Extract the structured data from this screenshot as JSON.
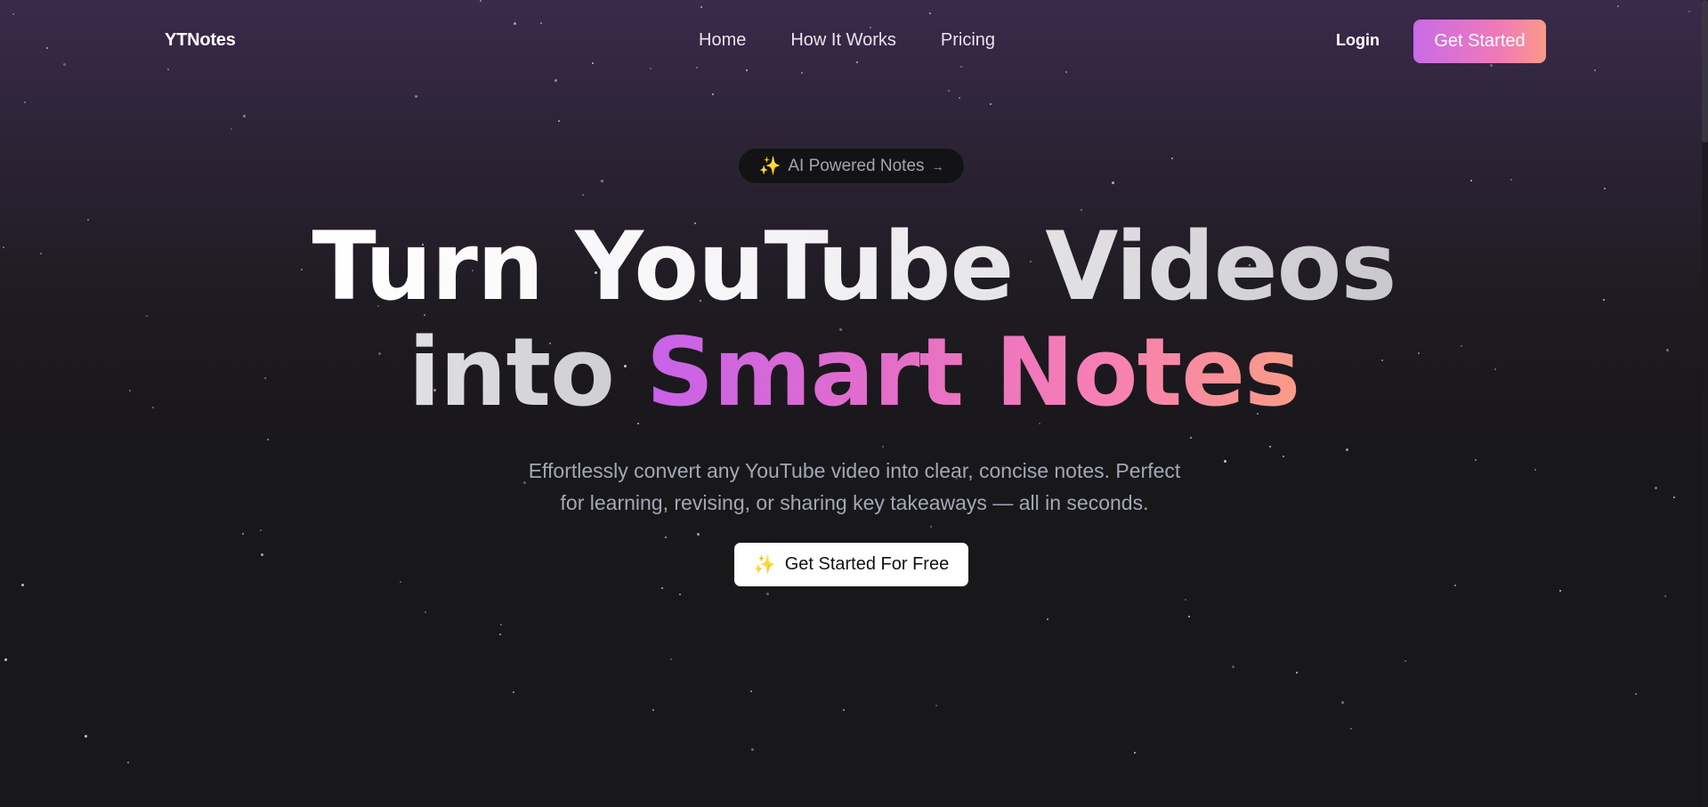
{
  "brand": {
    "logo": "YTNotes"
  },
  "nav": {
    "links": [
      "Home",
      "How It Works",
      "Pricing"
    ],
    "login": "Login",
    "cta": "Get Started"
  },
  "hero": {
    "badge": "AI Powered Notes",
    "badge_icon": "sparkles-icon",
    "badge_arrow_icon": "arrow-right-icon",
    "headline_line1": "Turn YouTube Videos",
    "headline_into": "into",
    "headline_accent": "Smart Notes",
    "subtitle_line1": "Effortlessly convert any YouTube video into clear, concise notes. Perfect",
    "subtitle_line2": "for learning, revising, or sharing key takeaways — all in seconds.",
    "cta": "Get Started For Free",
    "cta_icon": "sparkles-icon"
  },
  "colors": {
    "accent_start": "#c86be8",
    "accent_mid": "#f07ab7",
    "accent_end": "#f99a86",
    "background": "#18171a",
    "background_top": "#3b2a4b"
  }
}
